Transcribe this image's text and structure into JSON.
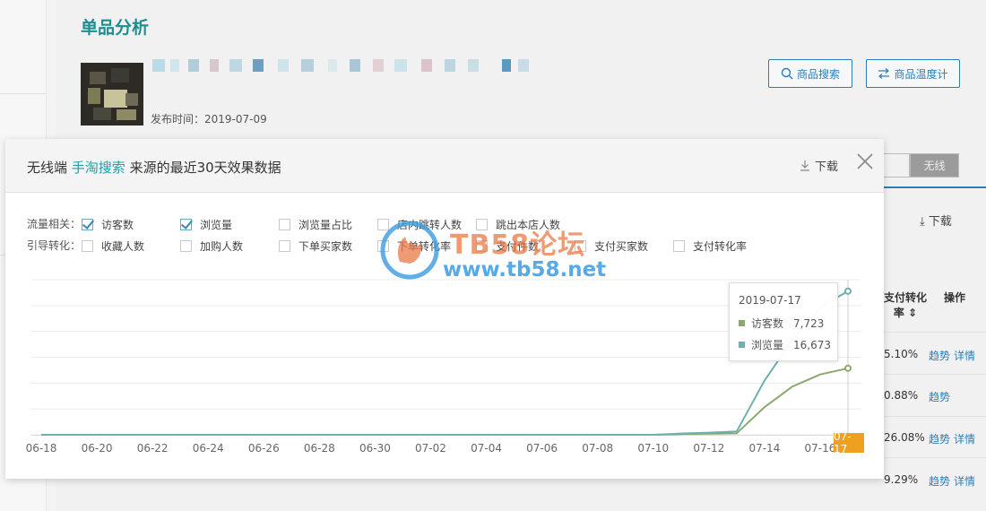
{
  "background": {
    "page_title": "单品分析",
    "publish_label": "发布时间：2019-07-09",
    "search_button": "商品搜索",
    "temp_button": "商品温度计",
    "toggle_left": "",
    "toggle_right": "无线",
    "download_label": "下载",
    "col_header_rate": "支付转化率",
    "col_header_action": "操作",
    "rows": [
      {
        "rate": "5.10%",
        "links": [
          "趋势",
          "详情"
        ]
      },
      {
        "rate": "0.88%",
        "links": [
          "趋势"
        ]
      },
      {
        "rate": "26.08%",
        "links": [
          "趋势",
          "详情"
        ]
      },
      {
        "rate": "9.29%",
        "links": [
          "趋势",
          "详情"
        ]
      }
    ]
  },
  "modal": {
    "title_prefix": "无线端",
    "title_source": "手淘搜索",
    "title_suffix": "来源的最近30天效果数据",
    "download_label": "下载",
    "close_icon": "close-icon",
    "filters": {
      "traffic_label": "流量相关：",
      "traffic_options": [
        {
          "label": "访客数",
          "checked": true
        },
        {
          "label": "浏览量",
          "checked": true
        },
        {
          "label": "浏览量占比",
          "checked": false
        },
        {
          "label": "店内跳转人数",
          "checked": false
        },
        {
          "label": "跳出本店人数",
          "checked": false
        }
      ],
      "guide_label": "引导转化：",
      "guide_options": [
        {
          "label": "收藏人数",
          "checked": false
        },
        {
          "label": "加购人数",
          "checked": false
        },
        {
          "label": "下单买家数",
          "checked": false
        },
        {
          "label": "下单转化率",
          "checked": false
        },
        {
          "label": "支付件数",
          "checked": false
        },
        {
          "label": "支付买家数",
          "checked": false
        },
        {
          "label": "支付转化率",
          "checked": false
        }
      ]
    },
    "tooltip": {
      "date": "2019-07-17",
      "series": [
        {
          "name": "访客数",
          "value": "7,723",
          "color": "#8aa86f"
        },
        {
          "name": "浏览量",
          "value": "16,673",
          "color": "#6fb0ae"
        }
      ]
    },
    "hover_date_label": "07-17"
  },
  "chart_data": {
    "type": "line",
    "x": [
      "06-18",
      "06-19",
      "06-20",
      "06-21",
      "06-22",
      "06-23",
      "06-24",
      "06-25",
      "06-26",
      "06-27",
      "06-28",
      "06-29",
      "06-30",
      "07-01",
      "07-02",
      "07-03",
      "07-04",
      "07-05",
      "07-06",
      "07-07",
      "07-08",
      "07-09",
      "07-10",
      "07-11",
      "07-12",
      "07-13",
      "07-14",
      "07-15",
      "07-16",
      "07-17"
    ],
    "x_tick_labels": [
      "06-18",
      "06-20",
      "06-22",
      "06-24",
      "06-26",
      "06-28",
      "06-30",
      "07-02",
      "07-04",
      "07-06",
      "07-08",
      "07-10",
      "07-12",
      "07-14",
      "07-16",
      "07-17"
    ],
    "series": [
      {
        "name": "访客数",
        "color": "#8aa86f",
        "values": [
          0,
          0,
          0,
          0,
          0,
          0,
          0,
          0,
          0,
          0,
          0,
          0,
          0,
          0,
          0,
          0,
          0,
          0,
          0,
          0,
          0,
          0,
          0,
          80,
          120,
          180,
          3200,
          5600,
          7000,
          7723
        ]
      },
      {
        "name": "浏览量",
        "color": "#6fb0ae",
        "values": [
          0,
          0,
          0,
          0,
          0,
          0,
          0,
          0,
          0,
          0,
          0,
          0,
          0,
          0,
          0,
          0,
          0,
          0,
          0,
          0,
          0,
          0,
          0,
          150,
          250,
          400,
          6300,
          11000,
          14800,
          16673
        ]
      }
    ],
    "ylim": [
      0,
      18000
    ],
    "grid": true,
    "legend": "none",
    "hover_index": 29
  },
  "watermark": {
    "title": "TB58论坛",
    "url": "www.tb58.net"
  },
  "colors": {
    "accent": "#1ba1a6",
    "link": "#2b7fb6",
    "highlight": "#f0a020"
  }
}
